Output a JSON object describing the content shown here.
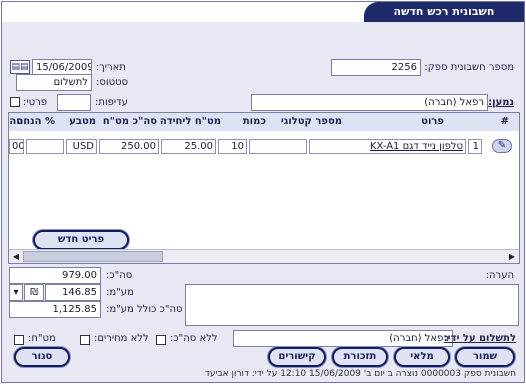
{
  "window": {
    "title": "חשבונית רכש חדשה"
  },
  "header": {
    "supplier_invoice_label": "מספר חשבונית ספק:",
    "supplier_invoice_value": "2256",
    "date_label": "תאריך:",
    "date_value": "15/06/2009",
    "status_label": "סטטוס:",
    "status_value": "לתשלום",
    "priority_label": "עדיפות:",
    "priority_value": "",
    "private_label": "פרטי:",
    "entity_label": "נמען:",
    "entity_value": "רפאל (חברה)"
  },
  "grid": {
    "columns": [
      "#",
      "פרוט",
      "מספר קטלוגי",
      "כמות",
      "מט\"ח ליחידה",
      "סה\"כ מט\"ח",
      "מטבע",
      "% הנחה",
      "סה"
    ],
    "rows": [
      {
        "num": "1",
        "detail": "טלפון נייד דגם KX-A1",
        "catalog": "",
        "qty": "10",
        "unit_price": "25.00",
        "total_fx": "250.00",
        "currency": "USD",
        "discount": "",
        "total": "00"
      }
    ],
    "new_item_button": "פריט חדש"
  },
  "totals": {
    "total_label": "סה\"כ:",
    "total_value": "979.00",
    "vat_label": "מע\"מ:",
    "vat_value": "146.85",
    "vat_currency": "₪",
    "grand_total_label": "סה\"כ כולל מע\"מ:",
    "grand_total_value": "1,125.85"
  },
  "notes": {
    "label": "הערה:",
    "value": ""
  },
  "payment": {
    "paid_by_label": "לתשלום על ידי:",
    "paid_by_value": "רפאל (חברה)",
    "no_total_label": "ללא סה\"כ:",
    "no_prices_label": "ללא מחירים:",
    "fx_label": "מט\"ח:"
  },
  "buttons": {
    "save": "שמור",
    "stock": "מלאי",
    "reminders": "תזכורת",
    "links": "קישורים",
    "close": "סגור"
  },
  "footer": {
    "text": "חשבונית ספק 0000003 נוצרה ב יום ב' 15/06/2009 12:10 על ידי: דורון אביעד"
  }
}
